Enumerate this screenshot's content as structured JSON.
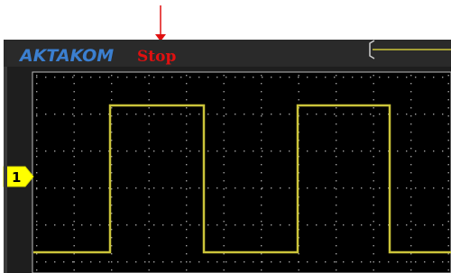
{
  "header": {
    "brand": "AKTAKOM",
    "run_state": "Stop"
  },
  "channel": {
    "label": "1"
  },
  "colors": {
    "background": "#000000",
    "header": "#2a2a2a",
    "frame": "#bdbdbd",
    "brand": "#3b7fd0",
    "run_state": "#e01010",
    "trace": "#cbc43a",
    "marker_fill": "#ffff00",
    "grid_dots": "#a0a0a0",
    "annotation_arrow": "#e01010"
  },
  "waveform": {
    "type": "square",
    "levels": [
      "low",
      "high",
      "low",
      "high",
      "low"
    ],
    "period_divisions": 4
  },
  "chart_data": {
    "type": "line",
    "series": [
      {
        "values": [
          0,
          0,
          1,
          1,
          0,
          0,
          1,
          1,
          0,
          0
        ]
      }
    ]
  }
}
